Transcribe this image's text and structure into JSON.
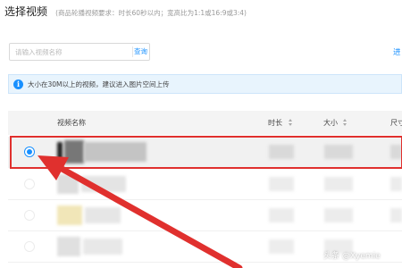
{
  "header": {
    "title": "选择视频",
    "subtitle": "(商品轮播视频要求：时长60秒以内；宽高比为1:1或16:9或3:4)"
  },
  "search": {
    "placeholder": "请输入视频名称",
    "button_label": "查询"
  },
  "more_link": "进",
  "notice": {
    "icon": "info-icon",
    "text": "大小在30M以上的视频，建议进入图片空间上传"
  },
  "table": {
    "columns": [
      "视频名称",
      "时长",
      "大小",
      "尺寸"
    ],
    "selected_row_index": 0,
    "row_count": 4
  },
  "colors": {
    "accent": "#1890ff",
    "highlight": "#e0302e",
    "info_bg": "#e8f4fd"
  },
  "watermark": "头条 @Xyemie"
}
